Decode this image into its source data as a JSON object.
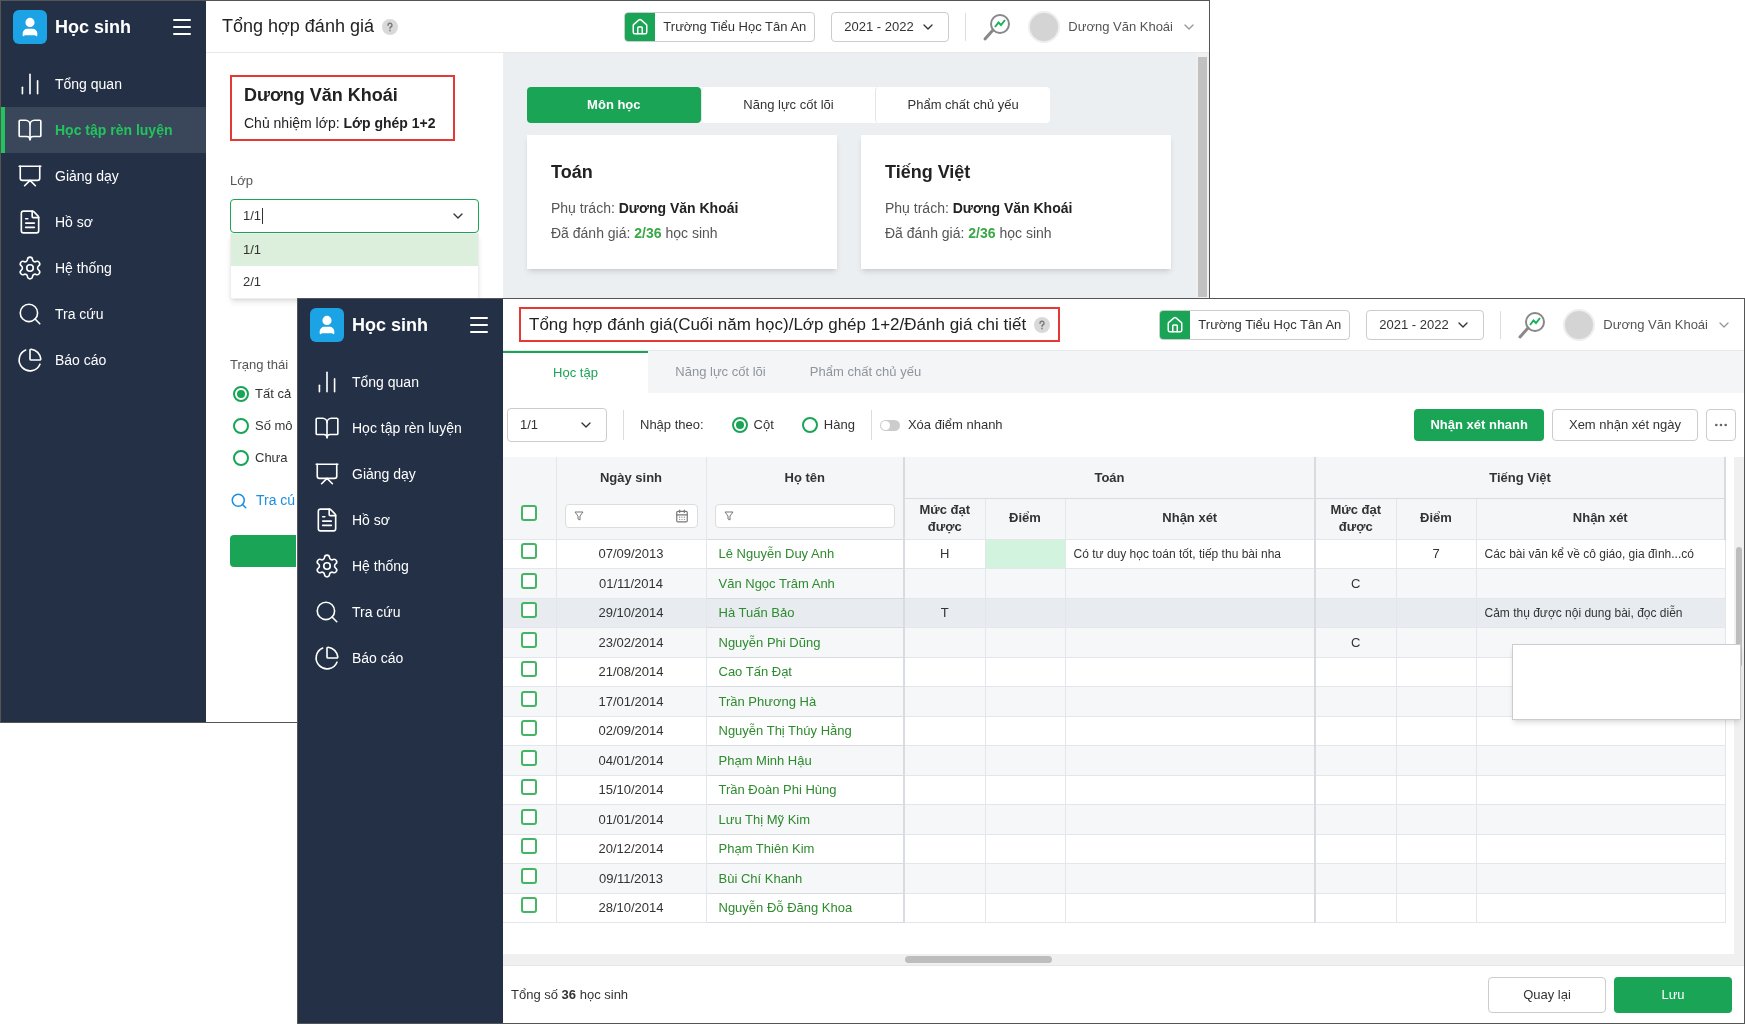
{
  "back_window": {
    "app_name": "Học sinh",
    "nav": [
      {
        "label": "Tổng quan",
        "selected": false
      },
      {
        "label": "Học tập rèn luyện",
        "selected": true
      },
      {
        "label": "Giảng dạy",
        "selected": false
      },
      {
        "label": "Hồ sơ",
        "selected": false
      },
      {
        "label": "Hệ thống",
        "selected": false
      },
      {
        "label": "Tra cứu",
        "selected": false
      },
      {
        "label": "Báo cáo",
        "selected": false
      }
    ],
    "header": {
      "title": "Tổng hợp đánh giá",
      "school": "Trường Tiểu Học Tân An",
      "year": "2021 - 2022",
      "user": "Dương Văn Khoái"
    },
    "teacher": {
      "name": "Dương Văn Khoái",
      "homeroom": "Chủ nhiệm lớp: **Lớp ghép 1+2**"
    },
    "class_field": {
      "label": "Lớp",
      "value": "1/1",
      "options": [
        {
          "label": "1/1",
          "selected": true
        },
        {
          "label": "2/1",
          "selected": false
        }
      ]
    },
    "status": {
      "label": "Trạng thái",
      "options": [
        {
          "label": "Tất cả",
          "selected": true
        },
        {
          "label": "Số mô",
          "selected": false
        },
        {
          "label": "Chưa",
          "selected": false
        }
      ]
    },
    "search_link": "Tra cú",
    "tabs": [
      {
        "label": "Môn học",
        "selected": true
      },
      {
        "label": "Năng lực cốt lõi",
        "selected": false
      },
      {
        "label": "Phẩm chất chủ yếu",
        "selected": false
      }
    ],
    "cards": [
      {
        "title": "Toán",
        "owner_label": "Phụ trách:",
        "owner": "Dương Văn Khoái",
        "assessed_label": "Đã đánh giá:",
        "assessed": "2/36",
        "assessed_suffix": "học sinh"
      },
      {
        "title": "Tiếng Việt",
        "owner_label": "Phụ trách:",
        "owner": "Dương Văn Khoái",
        "assessed_label": "Đã đánh giá:",
        "assessed": "2/36",
        "assessed_suffix": "học sinh"
      }
    ]
  },
  "front_window": {
    "app_name": "Học sinh",
    "nav": [
      {
        "label": "Tổng quan",
        "selected": false
      },
      {
        "label": "Học tập rèn luyện",
        "selected": false
      },
      {
        "label": "Giảng dạy",
        "selected": false
      },
      {
        "label": "Hồ sơ",
        "selected": false
      },
      {
        "label": "Hệ thống",
        "selected": false
      },
      {
        "label": "Tra cứu",
        "selected": false
      },
      {
        "label": "Báo cáo",
        "selected": false
      }
    ],
    "header": {
      "title": "Tổng hợp đánh giá(Cuối năm học)/Lớp ghép 1+2/Đánh giá chi tiết",
      "school": "Trường Tiểu Học Tân An",
      "year": "2021 - 2022",
      "user": "Dương Văn Khoái"
    },
    "tabs": [
      {
        "label": "Học tập",
        "selected": true,
        "disabled": false
      },
      {
        "label": "Năng lực cốt lõi",
        "selected": false,
        "disabled": true
      },
      {
        "label": "Phẩm chất chủ yếu",
        "selected": false,
        "disabled": true
      }
    ],
    "toolbar": {
      "class_select": "1/1",
      "input_mode_label": "Nhập theo:",
      "modes": [
        {
          "label": "Cột",
          "selected": true
        },
        {
          "label": "Hàng",
          "selected": false
        }
      ],
      "quick_delete": {
        "label": "Xóa điểm nhanh",
        "on": false
      },
      "buttons": [
        "Nhận xét nhanh",
        "Xem nhận xét ngày"
      ]
    },
    "table": {
      "all_checked": false,
      "birth_column": "Ngày sinh",
      "name_column": "Họ tên",
      "subjects": [
        {
          "name": "Toán",
          "columns": [
            "Mức đạt được",
            "Điểm",
            "Nhận xét"
          ]
        },
        {
          "name": "Tiếng Việt",
          "columns": [
            "Mức đạt được",
            "Điểm",
            "Nhận xét"
          ]
        }
      ],
      "rows": [
        {
          "birth": "07/09/2013",
          "name": "Lê Nguyễn Duy Anh",
          "checked": false,
          "hovered": false,
          "cells": [
            {
              "text": "H",
              "selected": false
            },
            {
              "selected": true
            },
            {
              "text": "Có tư duy học toán tốt, tiếp thu bài nha",
              "selected": false
            },
            {
              "selected": false
            },
            {
              "text": "7",
              "selected": false
            },
            {
              "text": "Các bài văn kể về cô giáo, gia đình...có",
              "selected": false
            }
          ]
        },
        {
          "birth": "01/11/2014",
          "name": "Văn Ngọc Trâm Anh",
          "checked": false,
          "hovered": false,
          "cells": [
            {
              "selected": false
            },
            {
              "selected": false
            },
            {
              "selected": false
            },
            {
              "text": "C",
              "selected": false
            },
            {
              "selected": false
            },
            {
              "selected": false
            }
          ]
        },
        {
          "birth": "29/10/2014",
          "name": "Hà Tuấn Bảo",
          "checked": false,
          "hovered": true,
          "cells": [
            {
              "text": "T",
              "selected": false
            },
            {
              "selected": false
            },
            {
              "selected": false
            },
            {
              "selected": false
            },
            {
              "selected": false
            },
            {
              "text": "Cảm thụ được nội dung bài, đọc diễn",
              "selected": false
            }
          ]
        },
        {
          "birth": "23/02/2014",
          "name": "Nguyễn Phi Dũng",
          "checked": false,
          "hovered": false,
          "cells": [
            {
              "selected": false
            },
            {
              "selected": false
            },
            {
              "selected": false
            },
            {
              "text": "C",
              "selected": false
            },
            {
              "selected": false
            },
            {
              "selected": false
            }
          ]
        },
        {
          "birth": "21/08/2014",
          "name": "Cao Tấn Đạt",
          "checked": false,
          "hovered": false
        },
        {
          "birth": "17/01/2014",
          "name": "Trần Phương Hà",
          "checked": false,
          "hovered": false
        },
        {
          "birth": "02/09/2014",
          "name": "Nguyễn Thị Thúy Hằng",
          "checked": false,
          "hovered": false
        },
        {
          "birth": "04/01/2014",
          "name": "Phạm Minh Hậu",
          "checked": false,
          "hovered": false
        },
        {
          "birth": "15/10/2014",
          "name": "Trần Đoàn Phi Hùng",
          "checked": false,
          "hovered": false
        },
        {
          "birth": "01/01/2014",
          "name": "Lưu Thị Mỹ Kim",
          "checked": false,
          "hovered": false
        },
        {
          "birth": "20/12/2014",
          "name": "Phạm Thiên Kim",
          "checked": false,
          "hovered": false
        },
        {
          "birth": "09/11/2013",
          "name": "Bùi Chí Khanh",
          "checked": false,
          "hovered": false
        },
        {
          "birth": "28/10/2014",
          "name": "Nguyễn Đỗ Đăng Khoa",
          "checked": false,
          "hovered": false
        }
      ]
    },
    "footer": {
      "total": "Tổng số **36** học sinh",
      "back": "Quay lại",
      "save": "Lưu"
    }
  }
}
